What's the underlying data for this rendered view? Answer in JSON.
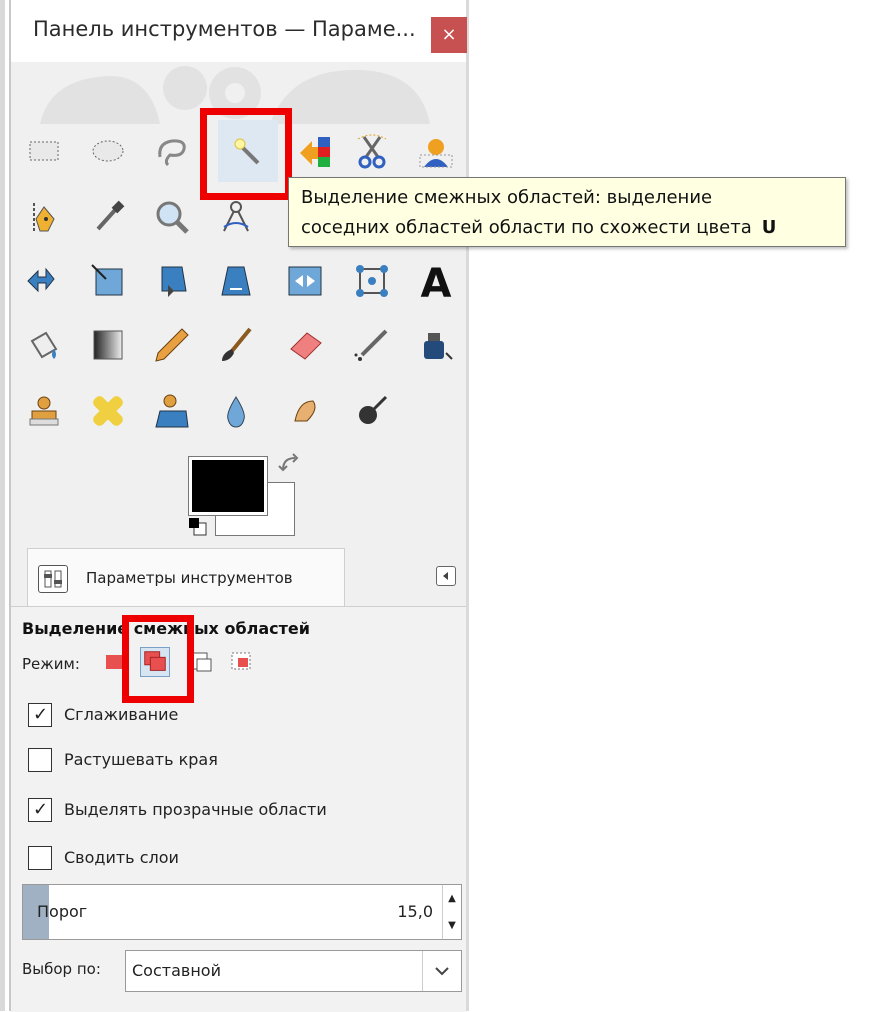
{
  "window": {
    "title": "Панель инструментов — Параме...",
    "close_label": "×"
  },
  "tooltip": {
    "line1": "Выделение смежных областей: выделение",
    "line2": "соседних областей области по схожести цвета",
    "shortcut": "U"
  },
  "tools": [
    {
      "name": "rect-select-icon"
    },
    {
      "name": "ellipse-select-icon"
    },
    {
      "name": "free-select-icon"
    },
    {
      "name": "fuzzy-select-icon",
      "selected": true
    },
    {
      "name": "color-select-icon"
    },
    {
      "name": "scissors-select-icon"
    },
    {
      "name": "foreground-select-icon"
    },
    {
      "name": "paths-icon"
    },
    {
      "name": "color-picker-icon"
    },
    {
      "name": "zoom-icon"
    },
    {
      "name": "measure-icon"
    },
    {
      "name": "move-icon"
    },
    {
      "name": "align-icon"
    },
    {
      "name": "crop-icon"
    },
    {
      "name": "rotate-icon"
    },
    {
      "name": "scale-icon"
    },
    {
      "name": "shear-icon"
    },
    {
      "name": "perspective-icon"
    },
    {
      "name": "flip-icon"
    },
    {
      "name": "cage-transform-icon"
    },
    {
      "name": "text-icon"
    },
    {
      "name": "bucket-fill-icon"
    },
    {
      "name": "gradient-icon"
    },
    {
      "name": "pencil-icon"
    },
    {
      "name": "paintbrush-icon"
    },
    {
      "name": "eraser-icon"
    },
    {
      "name": "airbrush-icon"
    },
    {
      "name": "ink-icon"
    },
    {
      "name": "clone-icon"
    },
    {
      "name": "heal-icon"
    },
    {
      "name": "perspective-clone-icon"
    },
    {
      "name": "blur-sharpen-icon"
    },
    {
      "name": "smudge-icon"
    },
    {
      "name": "dodge-burn-icon"
    }
  ],
  "colors": {
    "foreground": "#000000",
    "background": "#ffffff",
    "highlight": "#ee0000"
  },
  "tab": {
    "label": "Параметры инструментов"
  },
  "options": {
    "title": "Выделение смежных областей",
    "mode_label": "Режим:",
    "mode_selected_index": 1,
    "checkboxes": [
      {
        "label": "Сглаживание",
        "checked": true
      },
      {
        "label": "Растушевать края",
        "checked": false
      },
      {
        "label": "Выделять прозрачные области",
        "checked": true
      },
      {
        "label": "Сводить слои",
        "checked": false
      }
    ],
    "threshold": {
      "label": "Порог",
      "value": "15,0",
      "fraction": 0.06
    },
    "select_by": {
      "label": "Выбор по:",
      "value": "Составной"
    }
  }
}
